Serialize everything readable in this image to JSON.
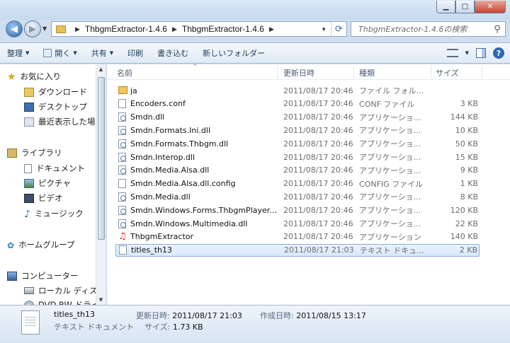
{
  "window": {
    "minimize": "▁",
    "maximize": "□",
    "close": "✕"
  },
  "address": {
    "crumbs": [
      "ThbgmExtractor-1.4.6",
      "ThbgmExtractor-1.4.6"
    ],
    "search_placeholder": "ThbgmExtractor-1.4.6の検索"
  },
  "toolbar": {
    "organize": "整理",
    "open": "開く",
    "share": "共有",
    "print": "印刷",
    "burn": "書き込む",
    "new_folder": "新しいフォルダー"
  },
  "nav": {
    "favorites": "お気に入り",
    "downloads": "ダウンロード",
    "desktop": "デスクトップ",
    "recent": "最近表示した場所",
    "libraries": "ライブラリ",
    "documents": "ドキュメント",
    "pictures": "ピクチャ",
    "videos": "ビデオ",
    "music": "ミュージック",
    "homegroup": "ホームグループ",
    "computer": "コンピューター",
    "local_disk": "ローカル ディスク",
    "dvd": "DVD RW ドライ"
  },
  "columns": {
    "name": "名前",
    "date": "更新日時",
    "type": "種類",
    "size": "サイズ"
  },
  "files": [
    {
      "icon": "folder",
      "name": "ja",
      "date": "2011/08/17 20:46",
      "type": "ファイル フォル...",
      "size": ""
    },
    {
      "icon": "doc",
      "name": "Encoders.conf",
      "date": "2011/08/17 20:46",
      "type": "CONF ファイル",
      "size": "3 KB"
    },
    {
      "icon": "dll",
      "name": "Smdn.dll",
      "date": "2011/08/17 20:46",
      "type": "アプリケーショ...",
      "size": "144 KB"
    },
    {
      "icon": "dll",
      "name": "Smdn.Formats.Ini.dll",
      "date": "2011/08/17 20:46",
      "type": "アプリケーショ...",
      "size": "10 KB"
    },
    {
      "icon": "dll",
      "name": "Smdn.Formats.Thbgm.dll",
      "date": "2011/08/17 20:46",
      "type": "アプリケーショ...",
      "size": "50 KB"
    },
    {
      "icon": "dll",
      "name": "Smdn.Interop.dll",
      "date": "2011/08/17 20:46",
      "type": "アプリケーショ...",
      "size": "15 KB"
    },
    {
      "icon": "dll",
      "name": "Smdn.Media.Alsa.dll",
      "date": "2011/08/17 20:46",
      "type": "アプリケーショ...",
      "size": "9 KB"
    },
    {
      "icon": "doc",
      "name": "Smdn.Media.Alsa.dll.config",
      "date": "2011/08/17 20:46",
      "type": "CONFIG ファイル",
      "size": "1 KB"
    },
    {
      "icon": "dll",
      "name": "Smdn.Media.dll",
      "date": "2011/08/17 20:46",
      "type": "アプリケーショ...",
      "size": "8 KB"
    },
    {
      "icon": "dll",
      "name": "Smdn.Windows.Forms.ThbgmPlayer....",
      "date": "2011/08/17 20:46",
      "type": "アプリケーショ...",
      "size": "120 KB"
    },
    {
      "icon": "dll",
      "name": "Smdn.Windows.Multimedia.dll",
      "date": "2011/08/17 20:46",
      "type": "アプリケーショ...",
      "size": "22 KB"
    },
    {
      "icon": "app",
      "name": "ThbgmExtractor",
      "date": "2011/08/17 20:46",
      "type": "アプリケーション",
      "size": "140 KB"
    },
    {
      "icon": "txt",
      "name": "titles_th13",
      "date": "2011/08/17 21:03",
      "type": "テキスト ドキュ...",
      "size": "2 KB",
      "selected": true
    }
  ],
  "details": {
    "name": "titles_th13",
    "type": "テキスト ドキュメント",
    "modified_label": "更新日時:",
    "modified_value": "2011/08/17 21:03",
    "created_label": "作成日時:",
    "created_value": "2011/08/15 13:17",
    "size_label": "サイズ:",
    "size_value": "1.73 KB"
  }
}
